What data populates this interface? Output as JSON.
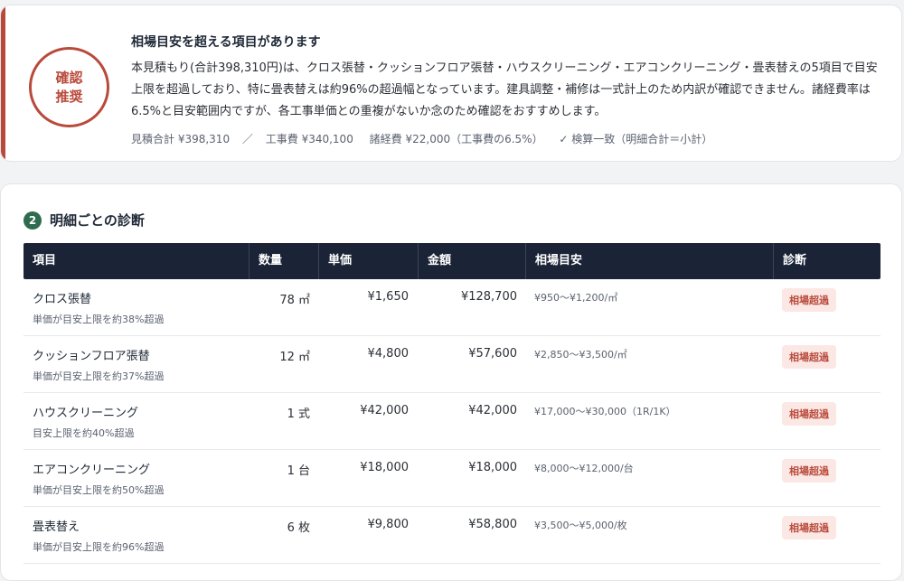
{
  "summary": {
    "stamp_line1": "確認",
    "stamp_line2": "推奨",
    "title": "相場目安を超える項目があります",
    "body": "本見積もり(合計398,310円)は、クロス張替・クッションフロア張替・ハウスクリーニング・エアコンクリーニング・畳表替えの5項目で目安上限を超過しており、特に畳表替えは約96%の超過幅となっています。建具調整・補修は一式計上のため内訳が確認できません。諸経費率は6.5%と目安範囲内ですが、各工事単価との重複がないか念のため確認をおすすめします。",
    "footer_total": "見積合計 ¥398,310",
    "footer_separator": "／",
    "footer_construction": "工事費 ¥340,100",
    "footer_misc": "諸経費 ¥22,000（工事費の6.5%）",
    "footer_check": "✓ 検算一致（明細合計＝小計）"
  },
  "detail": {
    "section_number": "2",
    "section_title": "明細ごとの診断",
    "headers": {
      "item": "項目",
      "qty": "数量",
      "unit_price": "単価",
      "amount": "金額",
      "market": "相場目安",
      "diagnosis": "診断"
    },
    "rows": [
      {
        "name": "クロス張替",
        "note": "単価が目安上限を約38%超過",
        "qty": "78 ㎡",
        "unit_price": "¥1,650",
        "amount": "¥128,700",
        "market": "¥950〜¥1,200/㎡",
        "diagnosis": "相場超過"
      },
      {
        "name": "クッションフロア張替",
        "note": "単価が目安上限を約37%超過",
        "qty": "12 ㎡",
        "unit_price": "¥4,800",
        "amount": "¥57,600",
        "market": "¥2,850〜¥3,500/㎡",
        "diagnosis": "相場超過"
      },
      {
        "name": "ハウスクリーニング",
        "note": "目安上限を約40%超過",
        "qty": "1 式",
        "unit_price": "¥42,000",
        "amount": "¥42,000",
        "market": "¥17,000〜¥30,000（1R/1K）",
        "diagnosis": "相場超過"
      },
      {
        "name": "エアコンクリーニング",
        "note": "単価が目安上限を約50%超過",
        "qty": "1 台",
        "unit_price": "¥18,000",
        "amount": "¥18,000",
        "market": "¥8,000〜¥12,000/台",
        "diagnosis": "相場超過"
      },
      {
        "name": "畳表替え",
        "note": "単価が目安上限を約96%超過",
        "qty": "6 枚",
        "unit_price": "¥9,800",
        "amount": "¥58,800",
        "market": "¥3,500〜¥5,000/枚",
        "diagnosis": "相場超過"
      }
    ]
  },
  "colors": {
    "accent_red": "#b94a3b",
    "header_navy": "#1b2436",
    "badge_bg": "#fbe7e4",
    "section_green": "#2f6b4f"
  }
}
